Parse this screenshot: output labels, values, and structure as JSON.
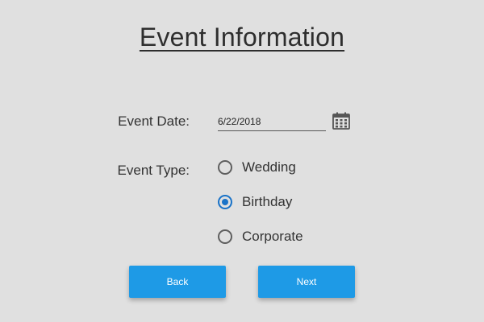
{
  "title": "Event Information",
  "event_date": {
    "label": "Event Date:",
    "value": "6/22/2018",
    "icon": "calendar-icon"
  },
  "event_type": {
    "label": "Event Type:",
    "options": [
      {
        "label": "Wedding",
        "selected": false
      },
      {
        "label": "Birthday",
        "selected": true
      },
      {
        "label": "Corporate",
        "selected": false
      }
    ]
  },
  "buttons": {
    "back": "Back",
    "next": "Next"
  },
  "colors": {
    "background": "#e0e0e0",
    "accent": "#1e9ae6",
    "radio_selected": "#1a73c8"
  }
}
